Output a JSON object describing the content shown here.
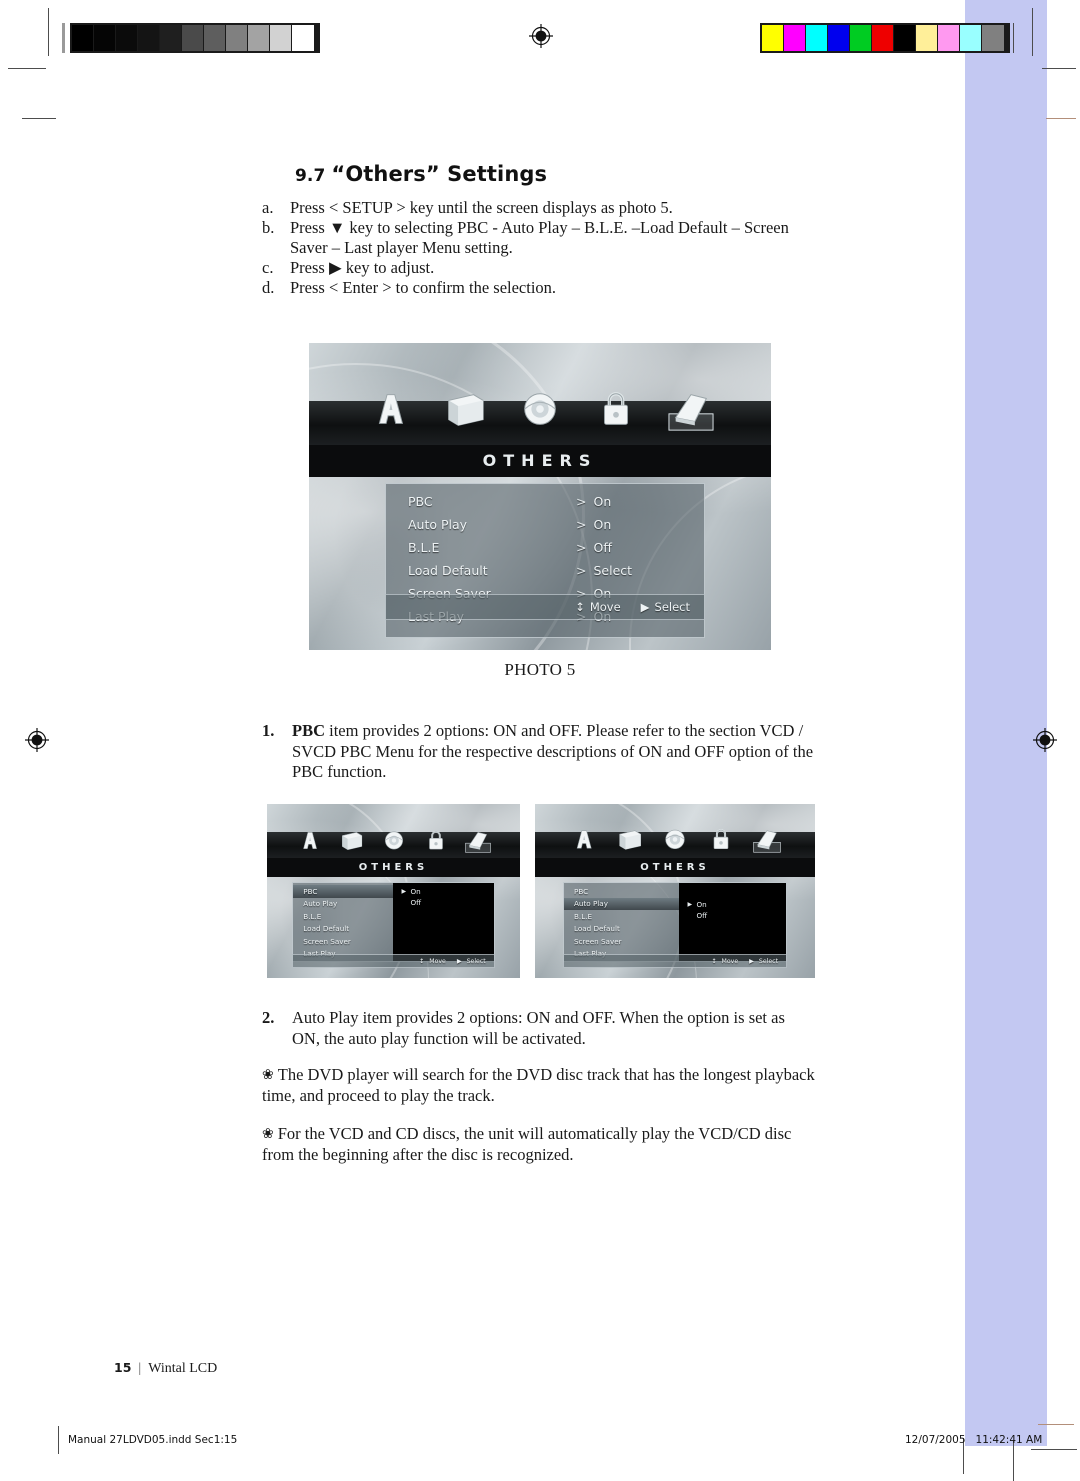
{
  "page": {
    "section_number": "9.7",
    "section_title": "“Others” Settings",
    "photo_caption": "PHOTO 5",
    "folio_page": "15",
    "folio_divider": "|",
    "folio_label": "Wintal LCD",
    "slug_left": "Manual 27LDVD05.indd   Sec1:15",
    "slug_date": "12/07/2005",
    "slug_time": "11:42:41 AM"
  },
  "steps": [
    {
      "key": "a.",
      "text": "Press < SETUP > key until the screen displays as photo 5."
    },
    {
      "key": "b.",
      "text": "Press ▼ key to selecting PBC - Auto Play – B.L.E. –Load Default – Screen Saver – Last player Menu setting."
    },
    {
      "key": "c.",
      "text": "Press ▶ key to adjust."
    },
    {
      "key": "d.",
      "text": "Press < Enter > to confirm the selection."
    }
  ],
  "paragraphs": {
    "p1_num": "1.",
    "p1_lead": "PBC",
    "p1_text": " item provides 2 options: ON and OFF. Please refer to the section VCD / SVCD PBC Menu for the respective descriptions of ON and OFF option of the PBC function.",
    "p2_num": "2.",
    "p2_text": "Auto Play item provides 2 options: ON and OFF. When the option is set as ON, the auto play function will be activated.",
    "p3_bullet": "❀",
    "p3_text": "The DVD player will search for the DVD disc track that has the longest playback time, and proceed to play the track.",
    "p4_bullet": "❀",
    "p4_text": "For the VCD and CD discs, the unit will automatically play the VCD/CD disc from the beginning after the disc is recognized."
  },
  "osd_main": {
    "title": "OTHERS",
    "icons": [
      "language-icon",
      "display-icon",
      "audio-icon",
      "parental-lock-icon",
      "others-folder-icon"
    ],
    "active_icon_index": 4,
    "rows": [
      {
        "label": "PBC",
        "caret": ">",
        "value": "On"
      },
      {
        "label": "Auto Play",
        "caret": ">",
        "value": "On"
      },
      {
        "label": "B.L.E",
        "caret": ">",
        "value": "Off"
      },
      {
        "label": "Load Default",
        "caret": ">",
        "value": "Select"
      },
      {
        "label": "Screen Saver",
        "caret": ">",
        "value": "On"
      },
      {
        "label": "Last Play",
        "caret": ">",
        "value": "On"
      }
    ],
    "footer": [
      {
        "glyph": "↕",
        "label": "Move"
      },
      {
        "glyph": "▶",
        "label": "Select"
      }
    ]
  },
  "osd_pbc": {
    "title": "OTHERS",
    "highlight_index": 0,
    "rows": [
      {
        "label": "PBC"
      },
      {
        "label": "Auto Play"
      },
      {
        "label": "B.L.E"
      },
      {
        "label": "Load Default"
      },
      {
        "label": "Screen Saver"
      },
      {
        "label": "Last Play"
      }
    ],
    "submenu": [
      {
        "caret": "▶",
        "label": "On"
      },
      {
        "caret": "",
        "label": "Off"
      }
    ],
    "footer": [
      {
        "glyph": "↕",
        "label": "Move"
      },
      {
        "glyph": "▶",
        "label": "Select"
      }
    ]
  },
  "osd_autoplay": {
    "title": "OTHERS",
    "highlight_index": 1,
    "rows": [
      {
        "label": "PBC"
      },
      {
        "label": "Auto Play"
      },
      {
        "label": "B.L.E"
      },
      {
        "label": "Load Default"
      },
      {
        "label": "Screen Saver"
      },
      {
        "label": "Last Play"
      }
    ],
    "submenu": [
      {
        "caret": "▶",
        "label": "On"
      },
      {
        "caret": "",
        "label": "Off"
      }
    ],
    "footer": [
      {
        "glyph": "↕",
        "label": "Move"
      },
      {
        "glyph": "▶",
        "label": "Select"
      }
    ]
  },
  "print_marks": {
    "grayscale_swatches": [
      "#000000",
      "#050505",
      "#0b0b0b",
      "#141414",
      "#1f1f1f",
      "#4a4a4a",
      "#5e5e5e",
      "#808080",
      "#a3a3a3",
      "#d2d2d2",
      "#ffffff"
    ],
    "color_swatches": [
      "#ffff00",
      "#ff00ff",
      "#00ffff",
      "#0000ee",
      "#00cc22",
      "#ee0000",
      "#000000",
      "#ffef99",
      "#ff99f0",
      "#99ffff",
      "#808080"
    ],
    "registration_mark": "registration-target",
    "side_band_color": "#c3c8f2"
  }
}
